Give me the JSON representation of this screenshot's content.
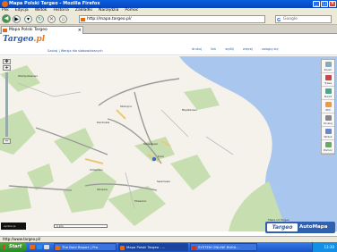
{
  "window": {
    "title": "Mapa Polski Targeo - Mozilla Firefox"
  },
  "menu": [
    "Plik",
    "Edycja",
    "Widok",
    "Historia",
    "Zakładki",
    "Narzędzia",
    "Pomoc"
  ],
  "nav": {
    "url": "http://mapa.targeo.pl/",
    "search_placeholder": "Google"
  },
  "tab": {
    "label": "Mapa Polski Targeo"
  },
  "site": {
    "logo_main": "Targeo",
    "logo_suffix": ".pl",
    "sublinks": "Szukaj | Wersja dla slabowidzacych",
    "top_links": [
      "drukuj",
      "link",
      "wyślij",
      "więcej",
      "zaloguj się"
    ]
  },
  "map": {
    "place_labels": [
      "Starzyno",
      "Darżlubie",
      "Błądzikowo",
      "Sławutowo",
      "Puck",
      "Chłapowo",
      "Strzelno",
      "Mrzezino",
      "Swarzewo",
      "Władysławowo"
    ],
    "tools": [
      "Zoom",
      "Trasa",
      "Punkt",
      "POI",
      "Drukuj",
      "Widok",
      "Pomoc"
    ],
    "scale_text": "1 km",
    "overlay_text": "Aplikacja"
  },
  "automapa": {
    "tagline": "Mapa od Targeo",
    "brand_left": "Targeo",
    "brand_right": "AutoMapa"
  },
  "status": {
    "text": "http://www.targeo.pl/"
  },
  "taskbar": {
    "start_label": "Start",
    "tasks": [
      {
        "label": "The Bold Report | Pro"
      },
      {
        "label": "Mapa Polski Targeo - ..."
      },
      {
        "label": "SYSTEM ONLINE BUKA..."
      }
    ],
    "clock": "13:30"
  }
}
